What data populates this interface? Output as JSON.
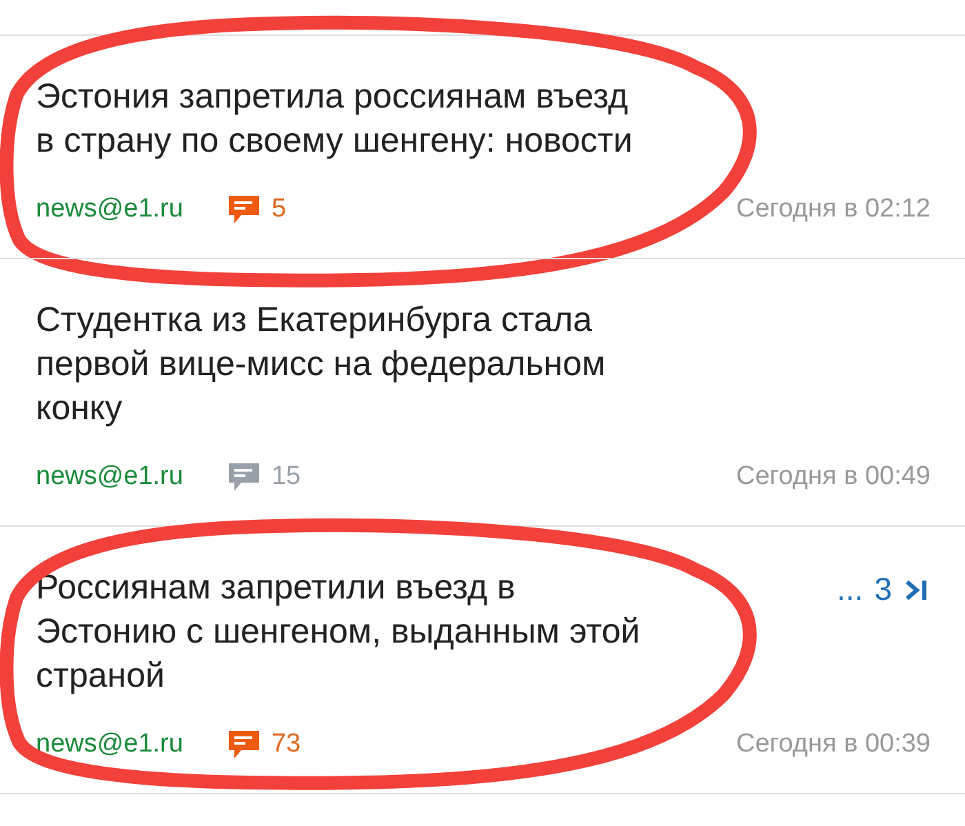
{
  "news": [
    {
      "title": "Эстония запретила россиянам въезд\nв страну по своему шенгену: новости",
      "source": "news@e1.ru",
      "comments": "5",
      "popular": true,
      "date": "Сегодня в 02:12",
      "circled": true
    },
    {
      "title": "Студентка из Екатеринбурга стала\nпервой вице-мисс на федеральном\nконку",
      "source": "news@e1.ru",
      "comments": "15",
      "popular": false,
      "date": "Сегодня в 00:49",
      "circled": false
    },
    {
      "title": "Россиянам запретили въезд в\nЭстонию с шенгеном, выданным этой\nстраной",
      "source": "news@e1.ru",
      "comments": "73",
      "popular": true,
      "date": "Сегодня в 00:39",
      "circled": true,
      "pager": {
        "ellipsis": "...",
        "page": "3"
      }
    }
  ]
}
